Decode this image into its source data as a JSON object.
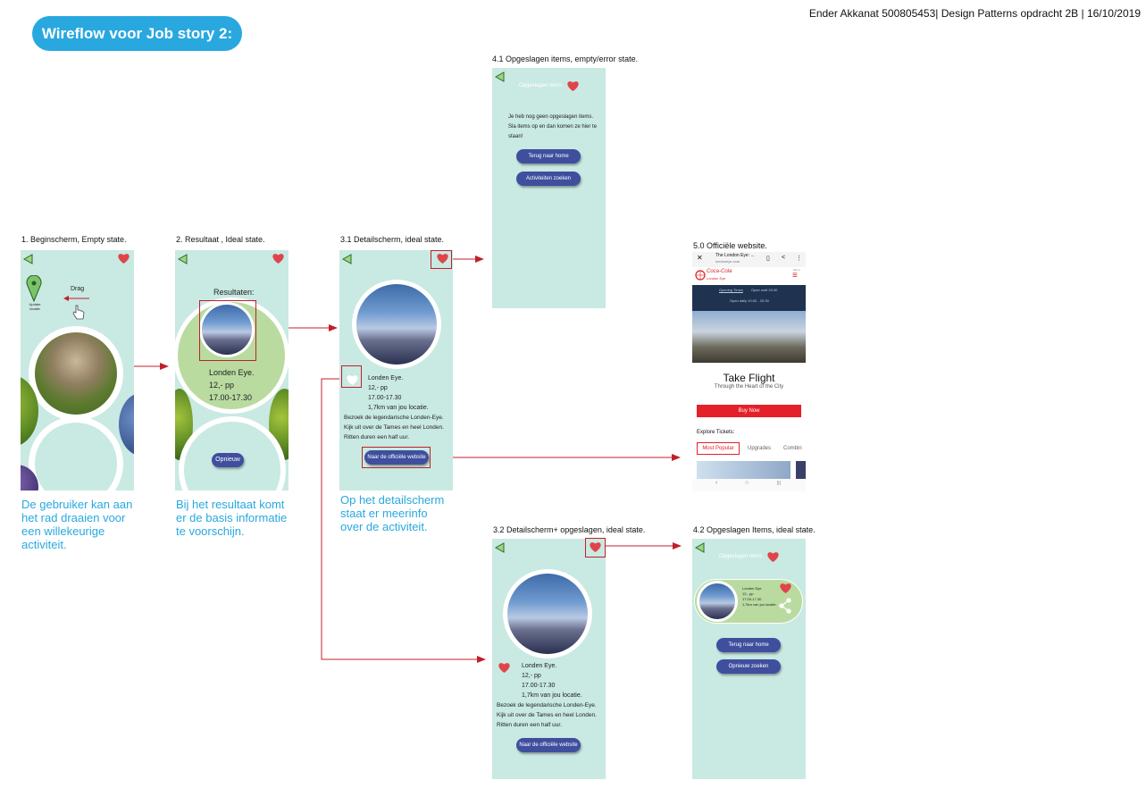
{
  "header": {
    "title": "Wireflow voor Job story 2:",
    "credit": "Ender Akkanat 500805453| Design Patterns opdracht 2B | 16/10/2019"
  },
  "colors": {
    "accent_blue": "#29a8df",
    "screen_bg": "#c9e9e3",
    "button_bg": "#3f4f9e",
    "arrow_red": "#c0202a",
    "heart_red": "#e0444a"
  },
  "screens": {
    "s1": {
      "label": "1. Beginscherm, Empty state.",
      "drag": "Drag",
      "pin_label": "Update locatie",
      "caption": "De gebruiker kan aan het rad draaien voor een willekeurige activiteit."
    },
    "s2": {
      "label": "2. Resultaat , Ideal state.",
      "results_title": "Resultaten:",
      "name": "Londen Eye.",
      "price": "12,- pp",
      "hours": "17.00-17.30",
      "button": "Opnieuw",
      "caption": "Bij het resultaat komt er de basis informatie te voorschijn."
    },
    "s31": {
      "label": "3.1 Detailscherm, ideal state.",
      "name": "Londen Eye.",
      "price": "12,- pp",
      "hours": "17.00-17.30",
      "distance": "1,7km van jou locatie.",
      "desc": "Bezoek de legendarische Londen-Eye. Kijk uit over de Tames en heel Londen. Ritten duren een half uur.",
      "button": "Naar de officiële website",
      "caption": "Op het detailscherm staat er meerinfo over de activiteit."
    },
    "s41": {
      "label": "4.1 Opgeslagen items, empty/error state.",
      "title": "Opgeslagen items.",
      "message": "Je heb nog geen opgeslagen items. Sla items op en dan komen ze hier te staan!",
      "button1": "Terug naar home",
      "button2": "Activiteiten zoeken"
    },
    "s50": {
      "label": "5.0 Officiële website.",
      "tab_title": "The London Eye: ...",
      "url": "londoneye.com",
      "brand_line1": "Coca-Cola",
      "brand_line2": "London Eye",
      "menu_hint": "Menu",
      "info1": "Opening Times",
      "info1_rest": "Open until 20:30",
      "info2": "Open daily 10:00 - 20:30",
      "hero_title": "Take Flight",
      "hero_sub": "Through the Heart of the City",
      "buy": "Buy Now",
      "explore": "Explore Tickets:",
      "tab1": "Most Popular",
      "tab2": "Upgrades",
      "tab3": "Combin",
      "nav": [
        "‹",
        "○",
        "|||"
      ]
    },
    "s32": {
      "label": "3.2 Detailscherm+ opgeslagen, ideal state.",
      "name": "Londen Eye.",
      "price": "12,- pp",
      "hours": "17.00-17.30",
      "distance": "1,7km van jou locatie.",
      "desc": "Bezoek de legendarische Londen-Eye. Kijk uit over de Tames en heel Londen. Ritten duren een half uur.",
      "button": "Naar de officiële website"
    },
    "s42": {
      "label": "4.2 Opgeslagen Items, ideal state.",
      "title": "Opgeslagen items.",
      "card_name": "Londen Eye.",
      "card_price": "12,- pp",
      "card_hours": "17.00-17.30",
      "card_distance": "1,7km van jou locatie.",
      "button1": "Terug naar home",
      "button2": "Opnieuw zoeken"
    }
  }
}
